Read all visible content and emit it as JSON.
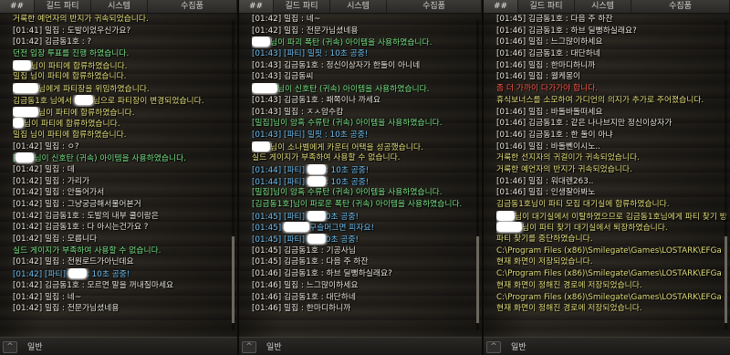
{
  "panels": [
    {
      "tabs": [
        "##",
        "길드 파티",
        "시스템",
        "수집품"
      ],
      "footer": {
        "label": "일반",
        "arrow": "^"
      },
      "lines": [
        {
          "c": "y",
          "t": "거룩한 예언자의 반지가 귀속되었습니다."
        },
        {
          "c": "w",
          "t": "[01:41] 밀집 : 도발이었우신가요?"
        },
        {
          "c": "w",
          "t": "[01:42] 김금동1호 : ?"
        },
        {
          "c": "g",
          "t": "던전 입장 투표를 진행 하였습니다."
        },
        {
          "c": "y",
          "b": "m",
          "t": "님이 파티에 합류하였습니다."
        },
        {
          "c": "y",
          "t": "밀집 님이 파티에 합류하였습니다."
        },
        {
          "c": "y",
          "b": "l",
          "t": "님에게 파티장을 위임하였습니다."
        },
        {
          "c": "y",
          "t": "김금동1호 님에서 ",
          "b2": "m",
          "t2": "님으로 파티장이 변경되었습니다."
        },
        {
          "c": "y",
          "b": "l",
          "t": "님이 파티에 합류하였습니다."
        },
        {
          "c": "y",
          "b": "s",
          "t": "님이 파티에 합류하였습니다."
        },
        {
          "c": "y",
          "t": "밀집 님이 파티에 합류하였습니다."
        },
        {
          "c": "w",
          "t": "[01:42] 밀집 : ㅇ?"
        },
        {
          "c": "g",
          "t": "[",
          "b2": "m",
          "t2": "님이 신호탄 (귀속) 아이템을 사용하였습니다."
        },
        {
          "c": "w",
          "t": "[01:42] 밀집 : 데"
        },
        {
          "c": "w",
          "t": "[01:42] 밀집 : 가리가"
        },
        {
          "c": "w",
          "t": "[01:42] 밀집 : 안들어가서"
        },
        {
          "c": "w",
          "t": "[01:42] 밀집 : 그냥궁금해서물어본거"
        },
        {
          "c": "w",
          "t": "[01:42] 김금동1호 : 도발의 내부 쿨이랑은"
        },
        {
          "c": "w",
          "t": "[01:42] 김금동1호 : 다 아시는건가요 ?"
        },
        {
          "c": "w",
          "t": "[01:42] 밀집 : 모릅니다"
        },
        {
          "c": "g",
          "t": "실드 게이지가 부족하여 사용할 수 없습니다."
        },
        {
          "c": "w",
          "t": "[01:42] 밀집 : 전원로드가아닌데요"
        },
        {
          "c": "b",
          "t": "[01:42] [파티] ",
          "b2": "m",
          "t2": ": 10초 공중!"
        },
        {
          "c": "w",
          "t": "[01:42] 김금동1호 : 모르면 말을 꺼내질마세요"
        },
        {
          "c": "w",
          "t": "[01:42] 밀집 : 네~"
        },
        {
          "c": "w",
          "t": "[01:42] 밀집 : 전문가님셨네용"
        }
      ]
    },
    {
      "tabs": [
        "##",
        "길드 파티",
        "시스템",
        "수집품"
      ],
      "footer": {
        "label": "일반",
        "arrow": "^"
      },
      "lines": [
        {
          "c": "w",
          "t": "[01:42] 밀집 : 네~"
        },
        {
          "c": "w",
          "t": "[01:42] 밀집 : 전문가님셨네용"
        },
        {
          "c": "g",
          "b": "m",
          "t": "님이 파괴 폭탄 (귀속) 아이템을 사용하였습니다."
        },
        {
          "c": "b",
          "t": "[01:43] [파티] 밀핏 : 10초 공중!"
        },
        {
          "c": "w",
          "t": "[01:43] 김금동1호 : 정신이상자가 한둘이 아니네"
        },
        {
          "c": "w",
          "t": "[01:43] 김금동씨"
        },
        {
          "c": "g",
          "b": "l",
          "t": "님이 신호탄 (귀속) 아이템을 사용하였습니다."
        },
        {
          "c": "w",
          "t": "[01:43] 김금동1호 : 패쪽이나 까세요"
        },
        {
          "c": "w",
          "t": "[01:43] 밀집 : ㅈㅅ암수캄"
        },
        {
          "c": "g",
          "t": "[밀집]님이 암흑 수류탄 (귀속) 아이템을 사용하였습니다."
        },
        {
          "c": "b",
          "t": "[01:43] [파티] 밀핏 : 10초 공중!"
        },
        {
          "c": "y",
          "b": "m",
          "t": "님이 소나벨에게 카운터 어택을 성공했습니다."
        },
        {
          "c": "y",
          "t": "실드 게이지가 부족하여 사용할 수 없습니다."
        },
        {
          "c": "b",
          "t": "[01:44] [파티] ",
          "b2": "m",
          "t2": ": 10초 공중!"
        },
        {
          "c": "b",
          "t": "[01:44] [파티] ",
          "b2": "m",
          "t2": ": 10초 공중!"
        },
        {
          "c": "g",
          "t": "[밀집]님이 암흑 수류탄 (귀속) 아이템을 사용하였습니다."
        },
        {
          "c": "g",
          "t": "[김금동1호]님이 파로운 폭탄 (귀속) 아이템을 사용하였습니다."
        },
        {
          "c": "b",
          "t": "[01:45] [파티] ",
          "b2": "m",
          "t2": "0초 공중!"
        },
        {
          "c": "b",
          "t": "[01:45] ",
          "b2": "l",
          "t2": "구슬머그면 피자요!"
        },
        {
          "c": "b",
          "t": "[01:45] [파티] ",
          "b2": "m",
          "t2": "0초 공중!"
        },
        {
          "c": "w",
          "t": "[01:45] 김금동1호 : 기공사님"
        },
        {
          "c": "w",
          "t": "[01:45] 김금동1호 : 다음 주 하잔"
        },
        {
          "c": "w",
          "t": "[01:46] 김금동1호 : 하브 딜뻥하실래요?"
        },
        {
          "c": "w",
          "t": "[01:46] 밀집 : 느그많이하세요"
        },
        {
          "c": "w",
          "t": "[01:46] 김금동1호 : 대단하네"
        },
        {
          "c": "w",
          "t": "[01:46] 밀집 : 한마디하니까"
        }
      ]
    },
    {
      "tabs": [
        "##",
        "길드 파티",
        "시스템",
        "수집품"
      ],
      "footer": {
        "label": "일반",
        "arrow": "^"
      },
      "lines": [
        {
          "c": "w",
          "t": "[01:45] 김금동1호 : 다음 주 하잔"
        },
        {
          "c": "w",
          "t": "[01:46] 김금동1호 : 하브 딜뻥하실래요?"
        },
        {
          "c": "w",
          "t": "[01:46] 밀집 : 느그많이하세요"
        },
        {
          "c": "w",
          "t": "[01:46] 김금동1호 : 대단하네"
        },
        {
          "c": "w",
          "t": "[01:46] 밀집 : 한마디하니까"
        },
        {
          "c": "w",
          "t": "[01:46] 밀집 : 웰케몽이"
        },
        {
          "c": "r",
          "t": "좀 더 가까이 다가가야 합니다."
        },
        {
          "c": "y",
          "t": "휴식보너스를 소모하여 가디언의 의지가 추가로 주어졌습니다."
        },
        {
          "c": "w",
          "t": "[01:46] 밀집 : 바돌바돌떠세요"
        },
        {
          "c": "w",
          "t": "[01:46] 김금동1호 : 같은 나나브지만 정신이상자가"
        },
        {
          "c": "w",
          "t": "[01:46] 김금동1호 : 한 둘이 아냐"
        },
        {
          "c": "w",
          "t": "[01:46] 밀집 : 바돌뻰이시노.."
        },
        {
          "c": "y",
          "t": "거룩한 선지자의 귀걸이가 귀속되었습니다."
        },
        {
          "c": "y",
          "t": "거룩한 예언자의 반지가 귀속되었습니다."
        },
        {
          "c": "w",
          "t": "[01:46] 밀집 : 워대렌263.."
        },
        {
          "c": "w",
          "t": "[01:46] 밀집 : 인생잘아봐노"
        },
        {
          "c": "y",
          "t": "김금동1호님이 파티 모집 대기실에 합류하였습니다."
        },
        {
          "c": "y",
          "b": "m",
          "t": "님이 대기실에서 이탈하였으므로 김금동1호님에게 파티 찾기 방"
        },
        {
          "c": "y",
          "b": "l",
          "t": "님이 파티 찾기 대기실에서 퇴장하였습니다."
        },
        {
          "c": "y",
          "t": "파티 찾기를 중단하였습니다."
        },
        {
          "c": "y",
          "t": "C:\\Program Files (x86)\\Smilegate\\Games\\LOSTARK\\EFGa"
        },
        {
          "c": "y",
          "t": "현재 화면이 저장되었습니다."
        },
        {
          "c": "y",
          "t": "C:\\Program Files (x86)\\Smilegate\\Games\\LOSTARK\\EFGa"
        },
        {
          "c": "y",
          "t": "현재 화면이 정해진 경로에 저장되었습니다."
        },
        {
          "c": "y",
          "t": "C:\\Program Files (x86)\\Smilegate\\Games\\LOSTARK\\EFGa"
        },
        {
          "c": "y",
          "t": "현재 화면이 정해진 경로에 저장되었습니다."
        }
      ]
    }
  ]
}
